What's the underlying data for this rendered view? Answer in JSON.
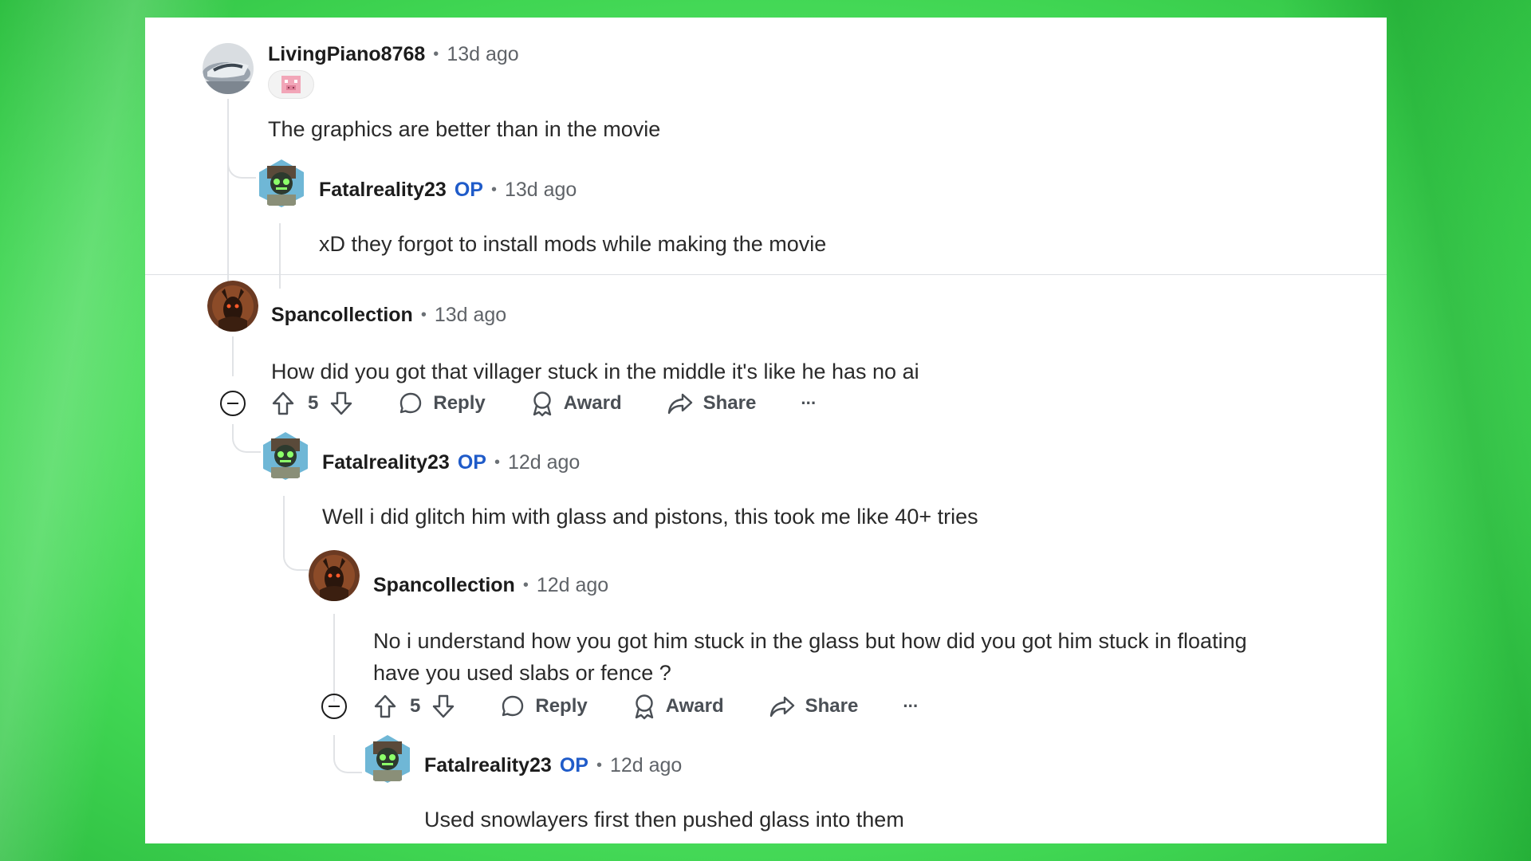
{
  "comments": [
    {
      "username": "LivingPiano8768",
      "op": "",
      "time": "13d ago",
      "body": "The graphics are better than in the movie",
      "avatar_icon": "car-avatar-icon",
      "flair_icon": "pig-flair-icon"
    },
    {
      "username": "Fatalreality23",
      "op": "OP",
      "time": "13d ago",
      "body": "xD they forgot to install mods while making the movie",
      "avatar_icon": "robot-avatar-icon"
    },
    {
      "username": "Spancollection",
      "op": "",
      "time": "13d ago",
      "body": "How did you got that villager stuck in the middle it's like he has no ai",
      "avatar_icon": "demon-avatar-icon",
      "votes": "5"
    },
    {
      "username": "Fatalreality23",
      "op": "OP",
      "time": "12d ago",
      "body": "Well i did glitch him with glass and pistons, this took me like 40+ tries",
      "avatar_icon": "robot-avatar-icon"
    },
    {
      "username": "Spancollection",
      "op": "",
      "time": "12d ago",
      "body_line1": "No i understand how you got him stuck in the glass but how did you got him stuck in floating",
      "body_line2": "have you used slabs or fence ?",
      "avatar_icon": "demon-avatar-icon",
      "votes": "5"
    },
    {
      "username": "Fatalreality23",
      "op": "OP",
      "time": "12d ago",
      "body": "Used snowlayers first then pushed glass into them",
      "avatar_icon": "robot-avatar-icon"
    }
  ],
  "actions": {
    "reply": "Reply",
    "award": "Award",
    "share": "Share",
    "more": "···"
  },
  "colors": {
    "op_blue": "#1f5bc9",
    "background_green": "#5fe86e"
  }
}
